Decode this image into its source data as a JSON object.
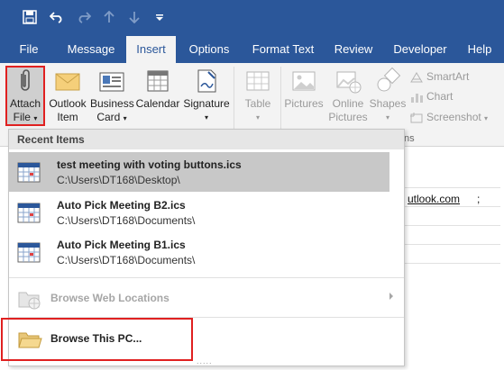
{
  "quick_access": {
    "icons": [
      "save-icon",
      "undo-icon",
      "redo-icon",
      "up-arrow-icon",
      "down-arrow-icon",
      "customize-icon"
    ]
  },
  "tabs": [
    {
      "label": "File",
      "active": false
    },
    {
      "label": "Message",
      "active": false
    },
    {
      "label": "Insert",
      "active": true
    },
    {
      "label": "Options",
      "active": false
    },
    {
      "label": "Format Text",
      "active": false
    },
    {
      "label": "Review",
      "active": false
    },
    {
      "label": "Developer",
      "active": false
    },
    {
      "label": "Help",
      "active": false
    }
  ],
  "ribbon": {
    "attach_file": {
      "line1": "Attach",
      "line2": "File"
    },
    "outlook_item": {
      "line1": "Outlook",
      "line2": "Item"
    },
    "business_card": {
      "line1": "Business",
      "line2": "Card"
    },
    "calendar": {
      "line1": "Calendar"
    },
    "signature": {
      "line1": "Signature"
    },
    "table": {
      "line1": "Table"
    },
    "pictures": {
      "line1": "Pictures"
    },
    "online_pictures": {
      "line1": "Online",
      "line2": "Pictures"
    },
    "shapes": {
      "line1": "Shapes"
    },
    "smartart": "SmartArt",
    "chart": "Chart",
    "screenshot": "Screenshot",
    "group_fragment": "ns"
  },
  "dropdown": {
    "header": "Recent Items",
    "recent_items": [
      {
        "name": "test meeting with voting buttons.ics",
        "path": "C:\\Users\\DT168\\Desktop\\",
        "selected": true
      },
      {
        "name": "Auto Pick Meeting B2.ics",
        "path": "C:\\Users\\DT168\\Documents\\",
        "selected": false
      },
      {
        "name": "Auto Pick Meeting B1.ics",
        "path": "C:\\Users\\DT168\\Documents\\",
        "selected": false
      }
    ],
    "browse_web": "Browse Web Locations",
    "browse_pc": "Browse This PC...",
    "grip": "....."
  },
  "compose": {
    "email_fragment": "utlook.com",
    "email_suffix": ";"
  },
  "colors": {
    "ribbon_blue": "#2b579a",
    "highlight_red": "#e02020",
    "selected_row": "#c8c8c8"
  }
}
